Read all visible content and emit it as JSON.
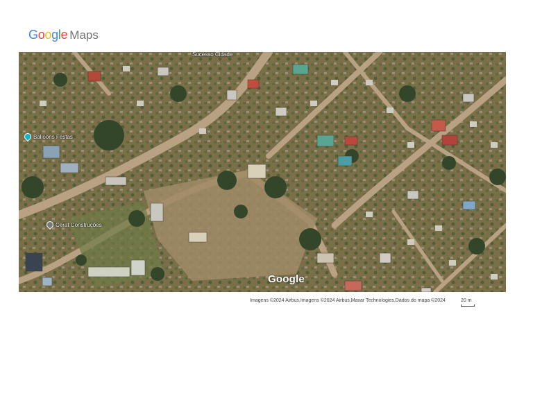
{
  "header": {
    "logo_letters": [
      "G",
      "o",
      "o",
      "g",
      "l",
      "e"
    ],
    "logo_colors": [
      "#4285F4",
      "#EA4335",
      "#FBBC05",
      "#4285F4",
      "#34A853",
      "#EA4335"
    ],
    "product": "Maps"
  },
  "map": {
    "type": "satellite",
    "labels": {
      "top_road": "Sucesso Cidade",
      "poi_party": "Balloons Festas",
      "poi_construction": "Cerat Construções"
    },
    "watermark": "Google"
  },
  "footer": {
    "attribution": "Imagens ©2024 Airbus,Imagens ©2024 Airbus,Maxar Technologies,Dados do mapa ©2024",
    "scale_label": "20 m"
  }
}
